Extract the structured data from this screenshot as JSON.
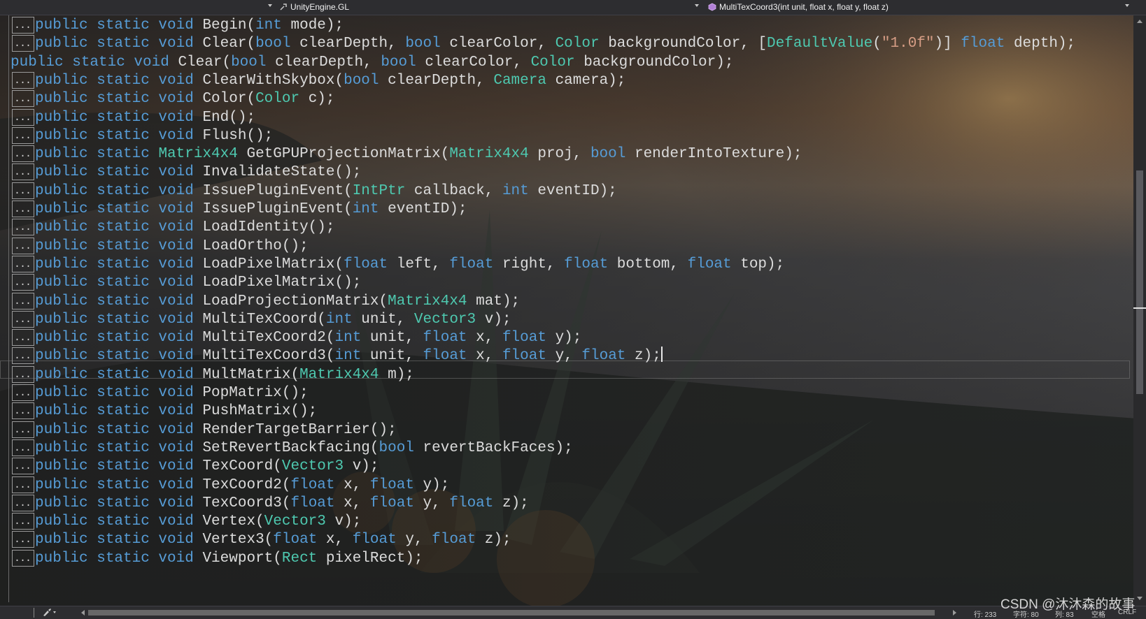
{
  "navbar": {
    "scope_icon": "wrench-icon",
    "type_name": "UnityEngine.GL",
    "member_icon": "method-cube-icon",
    "member_name": "MultiTexCoord3(int unit, float x, float y, float z)"
  },
  "code_lines": [
    {
      "folded": true,
      "segments": [
        [
          "kw",
          "public static void "
        ],
        [
          "pl",
          "Begin("
        ],
        [
          "kw",
          "int"
        ],
        [
          "pl",
          " mode);"
        ]
      ]
    },
    {
      "folded": true,
      "segments": [
        [
          "kw",
          "public static void "
        ],
        [
          "pl",
          "Clear("
        ],
        [
          "kw",
          "bool"
        ],
        [
          "pl",
          " clearDepth, "
        ],
        [
          "kw",
          "bool"
        ],
        [
          "pl",
          " clearColor, "
        ],
        [
          "ty",
          "Color"
        ],
        [
          "pl",
          " backgroundColor, ["
        ],
        [
          "ty",
          "DefaultValue"
        ],
        [
          "pl",
          "("
        ],
        [
          "st",
          "\"1.0f\""
        ],
        [
          "pl",
          ")] "
        ],
        [
          "kw",
          "float"
        ],
        [
          "pl",
          " depth);"
        ]
      ]
    },
    {
      "folded": false,
      "segments": [
        [
          "kw",
          "public static void "
        ],
        [
          "pl",
          "Clear("
        ],
        [
          "kw",
          "bool"
        ],
        [
          "pl",
          " clearDepth, "
        ],
        [
          "kw",
          "bool"
        ],
        [
          "pl",
          " clearColor, "
        ],
        [
          "ty",
          "Color"
        ],
        [
          "pl",
          " backgroundColor);"
        ]
      ]
    },
    {
      "folded": true,
      "segments": [
        [
          "kw",
          "public static void "
        ],
        [
          "pl",
          "ClearWithSkybox("
        ],
        [
          "kw",
          "bool"
        ],
        [
          "pl",
          " clearDepth, "
        ],
        [
          "ty",
          "Camera"
        ],
        [
          "pl",
          " camera);"
        ]
      ]
    },
    {
      "folded": true,
      "segments": [
        [
          "kw",
          "public static void "
        ],
        [
          "pl",
          "Color("
        ],
        [
          "ty",
          "Color"
        ],
        [
          "pl",
          " c);"
        ]
      ]
    },
    {
      "folded": true,
      "segments": [
        [
          "kw",
          "public static void "
        ],
        [
          "pl",
          "End();"
        ]
      ]
    },
    {
      "folded": true,
      "segments": [
        [
          "kw",
          "public static void "
        ],
        [
          "pl",
          "Flush();"
        ]
      ]
    },
    {
      "folded": true,
      "segments": [
        [
          "kw",
          "public static "
        ],
        [
          "ty",
          "Matrix4x4"
        ],
        [
          "pl",
          " GetGPUProjectionMatrix("
        ],
        [
          "ty",
          "Matrix4x4"
        ],
        [
          "pl",
          " proj, "
        ],
        [
          "kw",
          "bool"
        ],
        [
          "pl",
          " renderIntoTexture);"
        ]
      ]
    },
    {
      "folded": true,
      "segments": [
        [
          "kw",
          "public static void "
        ],
        [
          "pl",
          "InvalidateState();"
        ]
      ]
    },
    {
      "folded": true,
      "segments": [
        [
          "kw",
          "public static void "
        ],
        [
          "pl",
          "IssuePluginEvent("
        ],
        [
          "ty",
          "IntPtr"
        ],
        [
          "pl",
          " callback, "
        ],
        [
          "kw",
          "int"
        ],
        [
          "pl",
          " eventID);"
        ]
      ]
    },
    {
      "folded": true,
      "segments": [
        [
          "kw",
          "public static void "
        ],
        [
          "pl",
          "IssuePluginEvent("
        ],
        [
          "kw",
          "int"
        ],
        [
          "pl",
          " eventID);"
        ]
      ]
    },
    {
      "folded": true,
      "segments": [
        [
          "kw",
          "public static void "
        ],
        [
          "pl",
          "LoadIdentity();"
        ]
      ]
    },
    {
      "folded": true,
      "segments": [
        [
          "kw",
          "public static void "
        ],
        [
          "pl",
          "LoadOrtho();"
        ]
      ]
    },
    {
      "folded": true,
      "segments": [
        [
          "kw",
          "public static void "
        ],
        [
          "pl",
          "LoadPixelMatrix("
        ],
        [
          "kw",
          "float"
        ],
        [
          "pl",
          " left, "
        ],
        [
          "kw",
          "float"
        ],
        [
          "pl",
          " right, "
        ],
        [
          "kw",
          "float"
        ],
        [
          "pl",
          " bottom, "
        ],
        [
          "kw",
          "float"
        ],
        [
          "pl",
          " top);"
        ]
      ]
    },
    {
      "folded": true,
      "segments": [
        [
          "kw",
          "public static void "
        ],
        [
          "pl",
          "LoadPixelMatrix();"
        ]
      ]
    },
    {
      "folded": true,
      "segments": [
        [
          "kw",
          "public static void "
        ],
        [
          "pl",
          "LoadProjectionMatrix("
        ],
        [
          "ty",
          "Matrix4x4"
        ],
        [
          "pl",
          " mat);"
        ]
      ]
    },
    {
      "folded": true,
      "segments": [
        [
          "kw",
          "public static void "
        ],
        [
          "pl",
          "MultiTexCoord("
        ],
        [
          "kw",
          "int"
        ],
        [
          "pl",
          " unit, "
        ],
        [
          "ty",
          "Vector3"
        ],
        [
          "pl",
          " v);"
        ]
      ]
    },
    {
      "folded": true,
      "segments": [
        [
          "kw",
          "public static void "
        ],
        [
          "pl",
          "MultiTexCoord2("
        ],
        [
          "kw",
          "int"
        ],
        [
          "pl",
          " unit, "
        ],
        [
          "kw",
          "float"
        ],
        [
          "pl",
          " x, "
        ],
        [
          "kw",
          "float"
        ],
        [
          "pl",
          " y);"
        ]
      ]
    },
    {
      "folded": true,
      "current": true,
      "segments": [
        [
          "kw",
          "public static void "
        ],
        [
          "pl",
          "MultiTexCoord3("
        ],
        [
          "kw",
          "int"
        ],
        [
          "pl",
          " unit, "
        ],
        [
          "kw",
          "float"
        ],
        [
          "pl",
          " x, "
        ],
        [
          "kw",
          "float"
        ],
        [
          "pl",
          " y, "
        ],
        [
          "kw",
          "float"
        ],
        [
          "pl",
          " z);"
        ]
      ]
    },
    {
      "folded": true,
      "segments": [
        [
          "kw",
          "public static void "
        ],
        [
          "pl",
          "MultMatrix("
        ],
        [
          "ty",
          "Matrix4x4"
        ],
        [
          "pl",
          " m);"
        ]
      ]
    },
    {
      "folded": true,
      "segments": [
        [
          "kw",
          "public static void "
        ],
        [
          "pl",
          "PopMatrix();"
        ]
      ]
    },
    {
      "folded": true,
      "segments": [
        [
          "kw",
          "public static void "
        ],
        [
          "pl",
          "PushMatrix();"
        ]
      ]
    },
    {
      "folded": true,
      "segments": [
        [
          "kw",
          "public static void "
        ],
        [
          "pl",
          "RenderTargetBarrier();"
        ]
      ]
    },
    {
      "folded": true,
      "segments": [
        [
          "kw",
          "public static void "
        ],
        [
          "pl",
          "SetRevertBackfacing("
        ],
        [
          "kw",
          "bool"
        ],
        [
          "pl",
          " revertBackFaces);"
        ]
      ]
    },
    {
      "folded": true,
      "segments": [
        [
          "kw",
          "public static void "
        ],
        [
          "pl",
          "TexCoord("
        ],
        [
          "ty",
          "Vector3"
        ],
        [
          "pl",
          " v);"
        ]
      ]
    },
    {
      "folded": true,
      "segments": [
        [
          "kw",
          "public static void "
        ],
        [
          "pl",
          "TexCoord2("
        ],
        [
          "kw",
          "float"
        ],
        [
          "pl",
          " x, "
        ],
        [
          "kw",
          "float"
        ],
        [
          "pl",
          " y);"
        ]
      ]
    },
    {
      "folded": true,
      "segments": [
        [
          "kw",
          "public static void "
        ],
        [
          "pl",
          "TexCoord3("
        ],
        [
          "kw",
          "float"
        ],
        [
          "pl",
          " x, "
        ],
        [
          "kw",
          "float"
        ],
        [
          "pl",
          " y, "
        ],
        [
          "kw",
          "float"
        ],
        [
          "pl",
          " z);"
        ]
      ]
    },
    {
      "folded": true,
      "segments": [
        [
          "kw",
          "public static void "
        ],
        [
          "pl",
          "Vertex("
        ],
        [
          "ty",
          "Vector3"
        ],
        [
          "pl",
          " v);"
        ]
      ]
    },
    {
      "folded": true,
      "segments": [
        [
          "kw",
          "public static void "
        ],
        [
          "pl",
          "Vertex3("
        ],
        [
          "kw",
          "float"
        ],
        [
          "pl",
          " x, "
        ],
        [
          "kw",
          "float"
        ],
        [
          "pl",
          " y, "
        ],
        [
          "kw",
          "float"
        ],
        [
          "pl",
          " z);"
        ]
      ]
    },
    {
      "folded": true,
      "segments": [
        [
          "kw",
          "public static void "
        ],
        [
          "pl",
          "Viewport("
        ],
        [
          "ty",
          "Rect"
        ],
        [
          "pl",
          " pixelRect);"
        ]
      ]
    }
  ],
  "fold_marker": "...",
  "status": {
    "zoom_tool_icon": "brush-icon",
    "line": "行: 233",
    "char": "字符: 80",
    "col": "列: 83",
    "whitespace": "空格",
    "eol": "CRLF"
  },
  "watermark": "CSDN @沐沐森的故事",
  "colors": {
    "keyword": "#569cd6",
    "type": "#4ec9b0",
    "plain": "#dcdcdc",
    "string": "#d69d85",
    "chrome": "#2d2d30"
  }
}
